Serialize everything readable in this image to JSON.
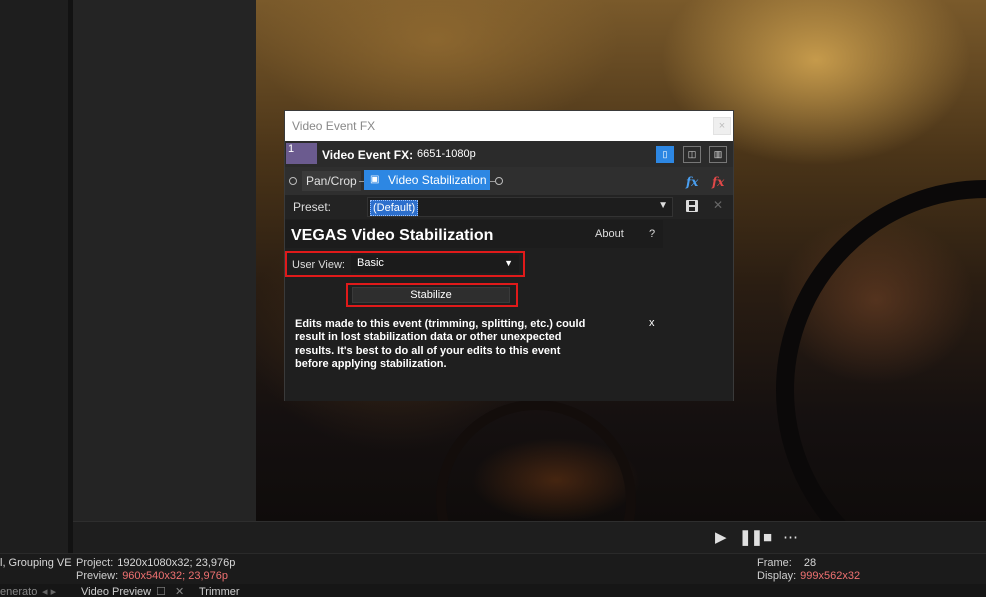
{
  "fx_window": {
    "title": "Video Event FX",
    "close_label": "×",
    "header_label": "Video Event FX:",
    "header_event": "6651-1080p",
    "thumb_label": "1",
    "chain": {
      "items": [
        "Pan/Crop",
        "Video Stabilization"
      ]
    },
    "preset": {
      "label": "Preset:",
      "value": "(Default)"
    },
    "plugin": {
      "title": "VEGAS Video Stabilization",
      "about_label": "About",
      "help_label": "?",
      "user_view_label": "User View:",
      "user_view_value": "Basic",
      "stabilize_label": "Stabilize",
      "warning": "Edits made to this event (trimming, splitting, etc.) could result in lost stabilization data or other unexpected results. It's best to do all of your edits to this event before applying stabilization.",
      "warning_close": "x"
    }
  },
  "status": {
    "left_text": "l, Grouping VE",
    "project_label": "Project:",
    "project_value": "1920x1080x32; 23,976p",
    "preview_label": "Preview:",
    "preview_value": "960x540x32; 23,976p",
    "frame_label": "Frame:",
    "frame_value": "28",
    "display_label": "Display:",
    "display_value": "999x562x32"
  },
  "tabs": {
    "generators": "enerato",
    "video_preview": "Video Preview",
    "trimmer": "Trimmer"
  },
  "colors": {
    "accent": "#2d87e3",
    "highlight_box": "#e01a1a",
    "status_red": "#f07171"
  }
}
